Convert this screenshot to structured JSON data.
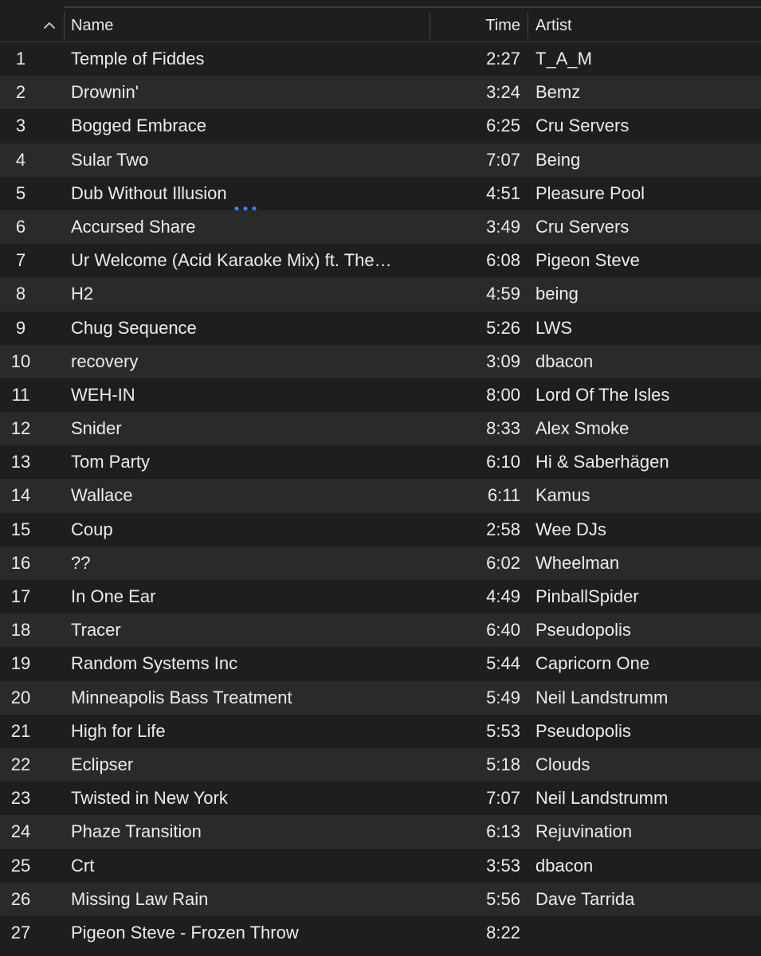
{
  "columns": {
    "name": "Name",
    "time": "Time",
    "artist": "Artist"
  },
  "icons": {
    "sort": "chevron-up-icon",
    "more": "ellipsis-icon"
  },
  "colors": {
    "background": "#1e1e1e",
    "row_alt": "#2a2a2a",
    "accent": "#2e86f5"
  },
  "tracks": [
    {
      "num": "1",
      "name": "Temple of Fiddes",
      "time": "2:27",
      "artist": "T_A_M"
    },
    {
      "num": "2",
      "name": "Drownin'",
      "time": "3:24",
      "artist": "Bemz"
    },
    {
      "num": "3",
      "name": "Bogged Embrace",
      "time": "6:25",
      "artist": "Cru Servers"
    },
    {
      "num": "4",
      "name": "Sular Two",
      "time": "7:07",
      "artist": "Being"
    },
    {
      "num": "5",
      "name": "Dub Without Illusion",
      "time": "4:51",
      "artist": "Pleasure Pool",
      "more": true
    },
    {
      "num": "6",
      "name": "Accursed Share",
      "time": "3:49",
      "artist": "Cru Servers"
    },
    {
      "num": "7",
      "name": "Ur Welcome (Acid Karaoke Mix) ft. The…",
      "time": "6:08",
      "artist": "Pigeon Steve"
    },
    {
      "num": "8",
      "name": "H2",
      "time": "4:59",
      "artist": "being"
    },
    {
      "num": "9",
      "name": "Chug Sequence",
      "time": "5:26",
      "artist": "LWS"
    },
    {
      "num": "10",
      "name": "recovery",
      "time": "3:09",
      "artist": "dbacon"
    },
    {
      "num": "11",
      "name": "WEH-IN",
      "time": "8:00",
      "artist": "Lord Of The Isles"
    },
    {
      "num": "12",
      "name": "Snider",
      "time": "8:33",
      "artist": "Alex Smoke"
    },
    {
      "num": "13",
      "name": "Tom Party",
      "time": "6:10",
      "artist": "Hi & Saberhägen"
    },
    {
      "num": "14",
      "name": "Wallace",
      "time": "6:11",
      "artist": "Kamus"
    },
    {
      "num": "15",
      "name": "Coup",
      "time": "2:58",
      "artist": "Wee DJs"
    },
    {
      "num": "16",
      "name": "??",
      "time": "6:02",
      "artist": "Wheelman"
    },
    {
      "num": "17",
      "name": "In One Ear",
      "time": "4:49",
      "artist": "PinballSpider"
    },
    {
      "num": "18",
      "name": "Tracer",
      "time": "6:40",
      "artist": "Pseudopolis"
    },
    {
      "num": "19",
      "name": "Random Systems Inc",
      "time": "5:44",
      "artist": "Capricorn One"
    },
    {
      "num": "20",
      "name": "Minneapolis Bass Treatment",
      "time": "5:49",
      "artist": "Neil Landstrumm"
    },
    {
      "num": "21",
      "name": "High for Life",
      "time": "5:53",
      "artist": "Pseudopolis"
    },
    {
      "num": "22",
      "name": "Eclipser",
      "time": "5:18",
      "artist": "Clouds"
    },
    {
      "num": "23",
      "name": "Twisted in New York",
      "time": "7:07",
      "artist": "Neil Landstrumm"
    },
    {
      "num": "24",
      "name": "Phaze Transition",
      "time": "6:13",
      "artist": "Rejuvination"
    },
    {
      "num": "25",
      "name": "Crt",
      "time": "3:53",
      "artist": "dbacon"
    },
    {
      "num": "26",
      "name": "Missing Law Rain",
      "time": "5:56",
      "artist": "Dave Tarrida"
    },
    {
      "num": "27",
      "name": "Pigeon Steve - Frozen Throw",
      "time": "8:22",
      "artist": ""
    }
  ]
}
